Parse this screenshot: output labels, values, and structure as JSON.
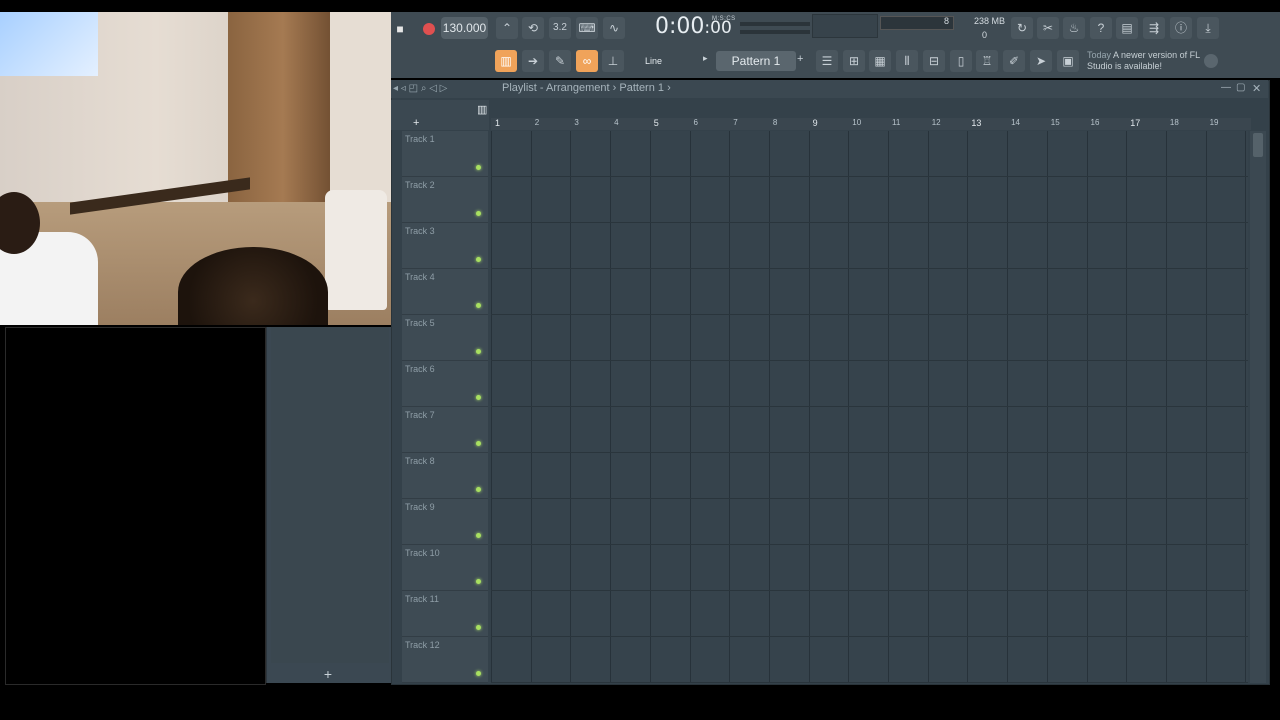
{
  "toolbar": {
    "tempo": "130.000",
    "time": "0:00",
    "time_sub": ":00",
    "time_label": "M:S:CS",
    "cpu": "8",
    "memory": "238 MB",
    "voices": "0",
    "snap": "Line",
    "pattern": "Pattern 1",
    "news_date": "Today",
    "news_text": "A newer version of FL Studio is available!"
  },
  "playlist": {
    "breadcrumb": "Playlist - Arrangement › Pattern 1 ›",
    "ruler": [
      "1",
      "2",
      "3",
      "4",
      "5",
      "6",
      "7",
      "8",
      "9",
      "10",
      "11",
      "12",
      "13",
      "14",
      "15",
      "16",
      "17",
      "18",
      "19"
    ],
    "tracks": [
      "Track 1",
      "Track 2",
      "Track 3",
      "Track 4",
      "Track 5",
      "Track 6",
      "Track 7",
      "Track 8",
      "Track 9",
      "Track 10",
      "Track 11",
      "Track 12"
    ]
  },
  "browser": {
    "add_label": "+"
  },
  "icons": [
    "stop-icon",
    "record-icon",
    "metronome-icon",
    "loop-icon",
    "typing-keyboard-icon",
    "step-edit-icon",
    "wave-icon",
    "undo-icon",
    "cut-icon",
    "mic-icon",
    "help-icon",
    "save-icon",
    "export-icon",
    "info-icon",
    "download-icon",
    "piano-roll-icon",
    "arrow-icon",
    "brush-icon",
    "link-icon",
    "stamp-icon",
    "mixer-icon",
    "channel-rack-icon",
    "browser-icon",
    "plugin-icon",
    "globe-icon"
  ],
  "colors": {
    "accent": "#f0a35a",
    "led": "#a8e060",
    "record": "#e05050"
  }
}
